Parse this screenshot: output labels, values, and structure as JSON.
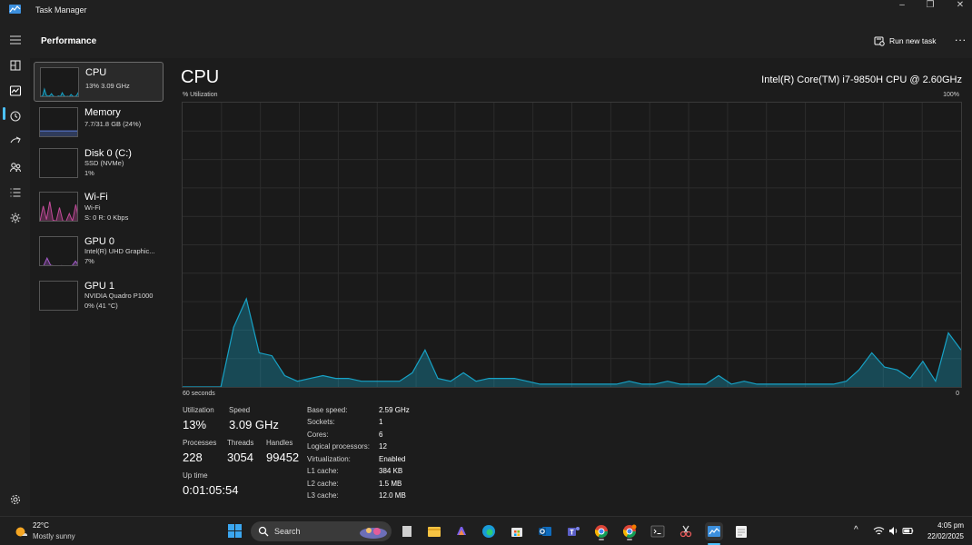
{
  "window": {
    "title": "Task Manager"
  },
  "header": {
    "page_title": "Performance",
    "run_new_task": "Run new task",
    "more": "..."
  },
  "sidebar": {
    "items": [
      {
        "name": "CPU",
        "line1": "13% 3.09 GHz",
        "line2": "",
        "graph_color": "#17a2c6",
        "selected": true,
        "spark": [
          5,
          8,
          30,
          10,
          6,
          8,
          15,
          6,
          5,
          5,
          7,
          5,
          18,
          8,
          5,
          6,
          5,
          12,
          6,
          5,
          8,
          18,
          10
        ]
      },
      {
        "name": "Memory",
        "line1": "7.7/31.8 GB (24%)",
        "line2": "",
        "graph_color": "#5a7bd8",
        "selected": false,
        "level": 24
      },
      {
        "name": "Disk 0 (C:)",
        "line1": "SSD (NVMe)",
        "line2": "1%",
        "graph_color": "#7fbf3f",
        "selected": false,
        "level": 1
      },
      {
        "name": "Wi-Fi",
        "line1": "Wi-Fi",
        "line2": "S: 0 R: 0 Kbps",
        "graph_color": "#c24b9a",
        "selected": false,
        "spark": [
          4,
          55,
          10,
          70,
          8,
          5,
          50,
          6,
          4,
          30,
          5,
          60,
          5
        ]
      },
      {
        "name": "GPU 0",
        "line1": "Intel(R) UHD Graphic...",
        "line2": "7%",
        "graph_color": "#a25bc7",
        "selected": false,
        "spark": [
          3,
          4,
          30,
          6,
          4,
          3,
          5,
          4,
          3,
          4,
          20,
          4
        ]
      },
      {
        "name": "GPU 1",
        "line1": "NVIDIA Quadro P1000",
        "line2": "0% (41 °C)",
        "graph_color": "#a25bc7",
        "selected": false
      }
    ]
  },
  "cpu": {
    "title": "CPU",
    "model": "Intel(R) Core(TM) i7-9850H CPU @ 2.60GHz",
    "util_label": "% Utilization",
    "max_label": "100%",
    "time_label": "60 seconds",
    "zero_label": "0",
    "stats": {
      "utilization_label": "Utilization",
      "utilization": "13%",
      "speed_label": "Speed",
      "speed": "3.09 GHz",
      "processes_label": "Processes",
      "processes": "228",
      "threads_label": "Threads",
      "threads": "3054",
      "handles_label": "Handles",
      "handles": "99452",
      "uptime_label": "Up time",
      "uptime": "0:01:05:54"
    },
    "specs": [
      {
        "label": "Base speed:",
        "value": "2.59 GHz"
      },
      {
        "label": "Sockets:",
        "value": "1"
      },
      {
        "label": "Cores:",
        "value": "6"
      },
      {
        "label": "Logical processors:",
        "value": "12"
      },
      {
        "label": "Virtualization:",
        "value": "Enabled"
      },
      {
        "label": "L1 cache:",
        "value": "384 KB"
      },
      {
        "label": "L2 cache:",
        "value": "1.5 MB"
      },
      {
        "label": "L3 cache:",
        "value": "12.0 MB"
      }
    ]
  },
  "chart_data": {
    "type": "area",
    "title": "CPU",
    "ylabel": "% Utilization",
    "xlabel": "60 seconds",
    "ylim": [
      0,
      100
    ],
    "xlim": [
      60,
      0
    ],
    "grid": true,
    "color": "#17a2c6",
    "x": [
      60,
      59,
      58,
      57,
      56,
      55,
      54,
      53,
      52,
      51,
      50,
      49,
      48,
      47,
      46,
      45,
      44,
      43,
      42,
      41,
      40,
      39,
      38,
      37,
      36,
      35,
      34,
      33,
      32,
      31,
      30,
      29,
      28,
      27,
      26,
      25,
      24,
      23,
      22,
      21,
      20,
      19,
      18,
      17,
      16,
      15,
      14,
      13,
      12,
      11,
      10,
      9,
      8,
      7,
      6,
      5,
      4,
      3,
      2,
      1,
      0
    ],
    "values": [
      0,
      0,
      0,
      0,
      21,
      31,
      12,
      11,
      4,
      2,
      3,
      4,
      3,
      3,
      2,
      2,
      2,
      2,
      5,
      13,
      3,
      2,
      5,
      2,
      3,
      3,
      3,
      2,
      1,
      1,
      1,
      1,
      1,
      1,
      1,
      2,
      1,
      1,
      2,
      1,
      1,
      1,
      4,
      1,
      2,
      1,
      1,
      1,
      1,
      1,
      1,
      1,
      2,
      6,
      12,
      7,
      6,
      3,
      9,
      2,
      19,
      13
    ]
  },
  "taskbar": {
    "weather_temp": "22°C",
    "weather_desc": "Mostly sunny",
    "search_label": "Search",
    "time": "4:05 pm",
    "date": "22/02/2025",
    "apps": [
      "file-icon",
      "file-explorer-icon",
      "copilot-icon",
      "edge-icon",
      "microsoft-store-icon",
      "outlook-icon",
      "teams-icon",
      "chrome-icon",
      "chrome-profile-icon",
      "terminal-icon",
      "snipping-tool-icon",
      "task-manager-icon",
      "notepad-icon"
    ]
  }
}
